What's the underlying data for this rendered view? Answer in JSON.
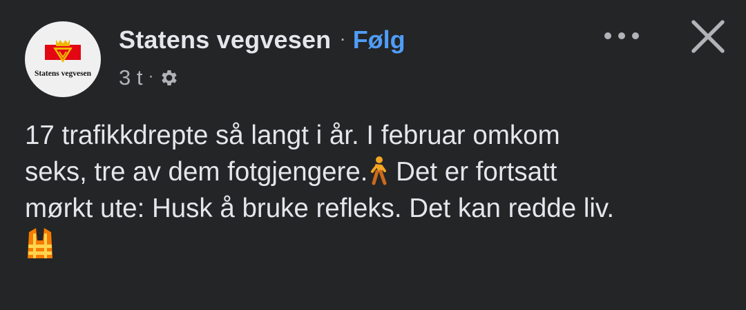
{
  "post": {
    "author": {
      "name": "Statens vegvesen",
      "avatar_text": "Statens vegvesen",
      "avatar_logo": "statens-vegvesen-logo"
    },
    "separator": "·",
    "follow_label": "Følg",
    "timestamp": "3 t",
    "audience_icon": "gear-icon",
    "more_icon": "more-horizontal-icon",
    "close_icon": "close-icon",
    "text": {
      "line1": "17 trafikkdrepte så langt i år. I februar omkom",
      "line2_before_emoji": "seks, tre av dem fotgjengere.",
      "emoji_1": "person-walking-emoji",
      "line2_after_emoji": " Det er fortsatt",
      "line3": "mørkt ute: Husk å bruke refleks. Det kan redde liv.",
      "emoji_2": "safety-vest-emoji"
    },
    "colors": {
      "background": "#242526",
      "text_primary": "#e4e6eb",
      "text_secondary": "#b0b3b8",
      "follow_blue": "#4f9df7"
    }
  }
}
